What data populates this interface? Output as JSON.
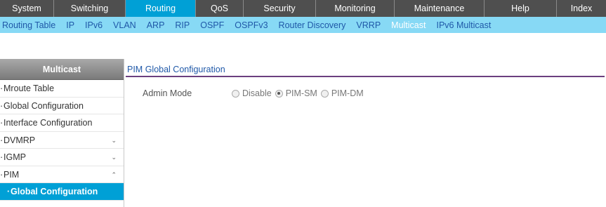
{
  "top_nav": [
    {
      "label": "System"
    },
    {
      "label": "Switching"
    },
    {
      "label": "Routing"
    },
    {
      "label": "QoS"
    },
    {
      "label": "Security"
    },
    {
      "label": "Monitoring"
    },
    {
      "label": "Maintenance"
    },
    {
      "label": "Help"
    },
    {
      "label": "Index"
    }
  ],
  "top_nav_active": "Routing",
  "sub_nav": [
    {
      "label": "Routing Table"
    },
    {
      "label": "IP"
    },
    {
      "label": "IPv6"
    },
    {
      "label": "VLAN"
    },
    {
      "label": "ARP"
    },
    {
      "label": "RIP"
    },
    {
      "label": "OSPF"
    },
    {
      "label": "OSPFv3"
    },
    {
      "label": "Router Discovery"
    },
    {
      "label": "VRRP"
    },
    {
      "label": "Multicast"
    },
    {
      "label": "IPv6 Multicast"
    }
  ],
  "sub_nav_active": "Multicast",
  "sidebar": {
    "header": "Multicast",
    "items": [
      {
        "label": "Mroute Table"
      },
      {
        "label": "Global Configuration"
      },
      {
        "label": "Interface Configuration"
      },
      {
        "label": "DVMRP"
      },
      {
        "label": "IGMP"
      },
      {
        "label": "PIM"
      },
      {
        "label": "Global Configuration"
      }
    ]
  },
  "main": {
    "section_title": "PIM Global Configuration",
    "admin_mode_label": "Admin Mode",
    "admin_mode_options": [
      {
        "label": "Disable",
        "checked": false
      },
      {
        "label": "PIM-SM",
        "checked": true
      },
      {
        "label": "PIM-DM",
        "checked": false
      }
    ]
  },
  "colors": {
    "top_nav_bg": "#4f4f4f",
    "accent": "#00a0d6",
    "sub_nav_bg": "#87d9f5",
    "link": "#1f58a8",
    "section_underline": "#6b3f7f"
  }
}
